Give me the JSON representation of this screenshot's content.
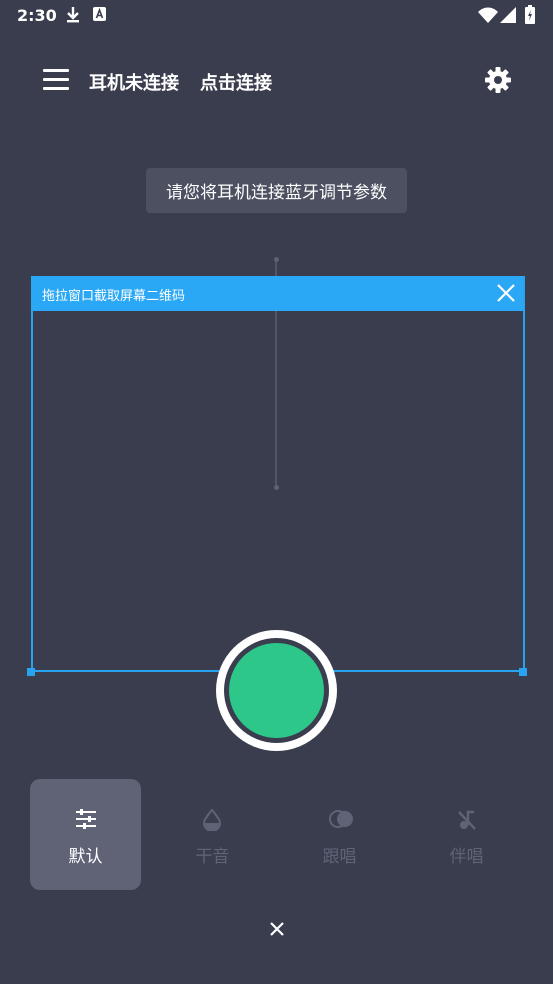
{
  "status_bar": {
    "time": "2:30",
    "left_icons": [
      "download-icon",
      "a-notification-icon"
    ],
    "right_icons": [
      "wifi-icon",
      "signal-icon",
      "battery-icon"
    ]
  },
  "header": {
    "menu_icon": "hamburger-icon",
    "connection_status": "耳机未连接",
    "connect_action": "点击连接",
    "settings_icon": "gear-icon"
  },
  "hint_text": "请您将耳机连接蓝牙调节参数",
  "capture_overlay": {
    "title": "拖拉窗口截取屏幕二维码",
    "accent_color": "#2aa7f5"
  },
  "main_button": {
    "color": "#2dc78a"
  },
  "modes": [
    {
      "label": "默认",
      "icon": "equalizer-icon",
      "active": true
    },
    {
      "label": "干音",
      "icon": "water-drop-icon",
      "active": false
    },
    {
      "label": "跟唱",
      "icon": "overlap-circles-icon",
      "active": false
    },
    {
      "label": "伴唱",
      "icon": "music-note-off-icon",
      "active": false
    }
  ],
  "colors": {
    "background": "#393d4e",
    "accent_green": "#2dc78a",
    "accent_blue": "#2aa7f5",
    "inactive_text": "#5f6376"
  }
}
